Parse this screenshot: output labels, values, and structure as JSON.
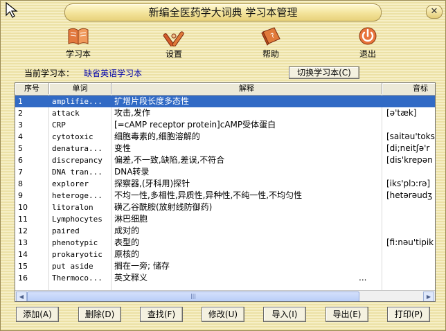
{
  "title": "新编全医药学大词典  学习本管理",
  "toolbar": [
    {
      "label": "学习本",
      "icon": "book-icon"
    },
    {
      "label": "设置",
      "icon": "settings-tools-icon"
    },
    {
      "label": "帮助",
      "icon": "help-book-icon"
    },
    {
      "label": "退出",
      "icon": "power-icon"
    }
  ],
  "current": {
    "label": "当前学习本：",
    "value": "缺省英语学习本"
  },
  "switch_label": "切换学习本(C)",
  "columns": [
    "序号",
    "单词",
    "解释",
    "音标"
  ],
  "rows": [
    {
      "no": "1",
      "word": "amplifie...",
      "def": "扩增片段长度多态性",
      "ph": ""
    },
    {
      "no": "2",
      "word": "attack",
      "def": "攻击,发作",
      "ph": "[ə'tæk]"
    },
    {
      "no": "3",
      "word": "CRP",
      "def": "[=cAMP receptor protein]cAMP受体蛋白",
      "ph": ""
    },
    {
      "no": "4",
      "word": "cytotoxic",
      "def": "细胞毒素的,细胞溶解的",
      "ph": "[saitəu'toks"
    },
    {
      "no": "5",
      "word": "denatura...",
      "def": "变性",
      "ph": "[di;neitʃə'r"
    },
    {
      "no": "6",
      "word": "discrepancy",
      "def": "偏差,不一致,缺陷,差误,不符合",
      "ph": "[dis'krepən"
    },
    {
      "no": "7",
      "word": "DNA tran...",
      "def": "DNA转录",
      "ph": ""
    },
    {
      "no": "8",
      "word": "explorer",
      "def": "探察器,(牙科用)探针",
      "ph": "[iks'plɔ:rə]"
    },
    {
      "no": "9",
      "word": "heteroge...",
      "def": "不均一性,多相性,异质性,异种性,不纯一性,不均匀性",
      "ph": "[hetərəudʒ"
    },
    {
      "no": "10",
      "word": "litoralon",
      "def": "磺乙谷酰胺(放射线防御药)",
      "ph": ""
    },
    {
      "no": "11",
      "word": "Lymphocytes",
      "def": "淋巴细胞",
      "ph": ""
    },
    {
      "no": "12",
      "word": "paired",
      "def": "成对的",
      "ph": ""
    },
    {
      "no": "13",
      "word": "phenotypic",
      "def": "表型的",
      "ph": "[fi:nəu'tipik"
    },
    {
      "no": "14",
      "word": "prokaryotic",
      "def": "原核的",
      "ph": ""
    },
    {
      "no": "15",
      "word": "put aside",
      "def": "搁在一旁; 储存",
      "ph": ""
    },
    {
      "no": "16",
      "word": "Thermoco...",
      "def": "英文释义",
      "ph": ""
    }
  ],
  "more_indicator": "...",
  "buttons": [
    "添加(A)",
    "删除(D)",
    "查找(F)",
    "修改(U)",
    "导入(I)",
    "导出(E)",
    "打印(P)"
  ]
}
